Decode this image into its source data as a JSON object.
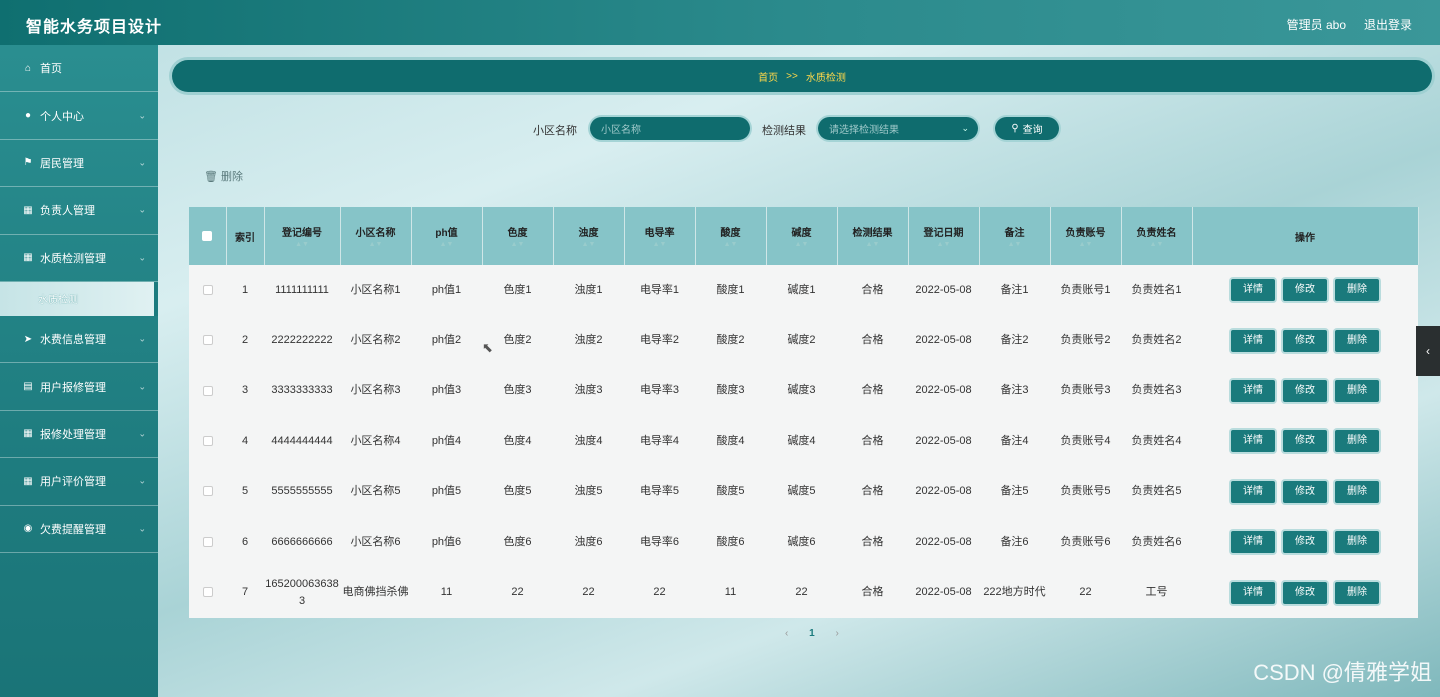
{
  "header": {
    "title": "智能水务项目设计",
    "user": "管理员 abo",
    "logout": "退出登录"
  },
  "sidebar": {
    "items": [
      {
        "label": "首页",
        "icon": "home-icon",
        "glyph": "⌂",
        "chevron": false
      },
      {
        "label": "个人中心",
        "icon": "user-icon",
        "glyph": "●",
        "chevron": true
      },
      {
        "label": "居民管理",
        "icon": "flag-icon",
        "glyph": "⚑",
        "chevron": true
      },
      {
        "label": "负责人管理",
        "icon": "grid-icon",
        "glyph": "▦",
        "chevron": true
      },
      {
        "label": "水质检测管理",
        "icon": "grid-icon",
        "glyph": "▦",
        "chevron": true,
        "sub": "水质检测"
      },
      {
        "label": "水费信息管理",
        "icon": "send-icon",
        "glyph": "➤",
        "chevron": true
      },
      {
        "label": "用户报修管理",
        "icon": "clipboard-icon",
        "glyph": "▤",
        "chevron": true
      },
      {
        "label": "报修处理管理",
        "icon": "grid-icon",
        "glyph": "▦",
        "chevron": true
      },
      {
        "label": "用户评价管理",
        "icon": "grid-icon",
        "glyph": "▦",
        "chevron": true
      },
      {
        "label": "欠费提醒管理",
        "icon": "pin-icon",
        "glyph": "◉",
        "chevron": true
      }
    ]
  },
  "breadcrumb": {
    "home": "首页",
    "sep": ">>",
    "current": "水质检测"
  },
  "search": {
    "community_label": "小区名称",
    "community_placeholder": "小区名称",
    "result_label": "检测结果",
    "result_placeholder": "请选择检测结果",
    "search_button": "查询"
  },
  "toolbar": {
    "delete": "删除"
  },
  "table": {
    "headers": [
      "索引",
      "登记编号",
      "小区名称",
      "ph值",
      "色度",
      "浊度",
      "电导率",
      "酸度",
      "碱度",
      "检测结果",
      "登记日期",
      "备注",
      "负责账号",
      "负责姓名",
      "操作"
    ],
    "rows": [
      [
        "1",
        "1111111111",
        "小区名称1",
        "ph值1",
        "色度1",
        "浊度1",
        "电导率1",
        "酸度1",
        "碱度1",
        "合格",
        "2022-05-08",
        "备注1",
        "负责账号1",
        "负责姓名1"
      ],
      [
        "2",
        "2222222222",
        "小区名称2",
        "ph值2",
        "色度2",
        "浊度2",
        "电导率2",
        "酸度2",
        "碱度2",
        "合格",
        "2022-05-08",
        "备注2",
        "负责账号2",
        "负责姓名2"
      ],
      [
        "3",
        "3333333333",
        "小区名称3",
        "ph值3",
        "色度3",
        "浊度3",
        "电导率3",
        "酸度3",
        "碱度3",
        "合格",
        "2022-05-08",
        "备注3",
        "负责账号3",
        "负责姓名3"
      ],
      [
        "4",
        "4444444444",
        "小区名称4",
        "ph值4",
        "色度4",
        "浊度4",
        "电导率4",
        "酸度4",
        "碱度4",
        "合格",
        "2022-05-08",
        "备注4",
        "负责账号4",
        "负责姓名4"
      ],
      [
        "5",
        "5555555555",
        "小区名称5",
        "ph值5",
        "色度5",
        "浊度5",
        "电导率5",
        "酸度5",
        "碱度5",
        "合格",
        "2022-05-08",
        "备注5",
        "负责账号5",
        "负责姓名5"
      ],
      [
        "6",
        "6666666666",
        "小区名称6",
        "ph值6",
        "色度6",
        "浊度6",
        "电导率6",
        "酸度6",
        "碱度6",
        "合格",
        "2022-05-08",
        "备注6",
        "负责账号6",
        "负责姓名6"
      ],
      [
        "7",
        "1652000636383",
        "电商佛挡杀佛",
        "11",
        "22",
        "22",
        "22",
        "11",
        "22",
        "合格",
        "2022-05-08",
        "222地方时代",
        "22",
        "工号"
      ]
    ],
    "actions": [
      "详情",
      "修改",
      "删除"
    ]
  },
  "pager": {
    "prev": "‹",
    "page": "1",
    "next": "›"
  },
  "watermark": "CSDN @倩雅学姐",
  "colors": {
    "primary": "#0f6c6e",
    "header_row": "#86c4c8",
    "breadcrumb_text": "#ffd84a"
  }
}
